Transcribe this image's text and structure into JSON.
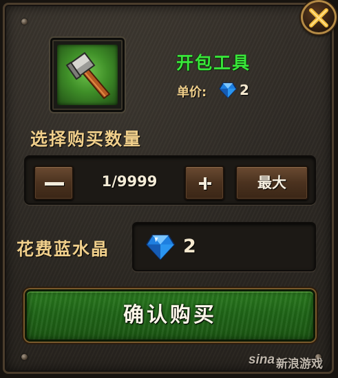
{
  "item": {
    "name": "开包工具",
    "icon": "hammer-icon"
  },
  "price": {
    "label": "单价:",
    "currency_icon": "blue-crystal-icon",
    "value": "2"
  },
  "quantity": {
    "title": "选择购买数量",
    "value": "1/9999",
    "decrease_icon": "minus-icon",
    "increase_icon": "plus-icon",
    "max_label": "最大"
  },
  "cost": {
    "label": "花费蓝水晶",
    "currency_icon": "blue-crystal-icon",
    "value": "2"
  },
  "confirm": {
    "label": "确认购买"
  },
  "close_icon": "close-icon",
  "watermark": {
    "logo": "sina",
    "text": "新浪游戏"
  },
  "colors": {
    "item_name": "#39e63a",
    "label_gold": "#f0cf8b",
    "confirm_green": "#1f6517",
    "crystal_blue": "#1e7fe0"
  }
}
